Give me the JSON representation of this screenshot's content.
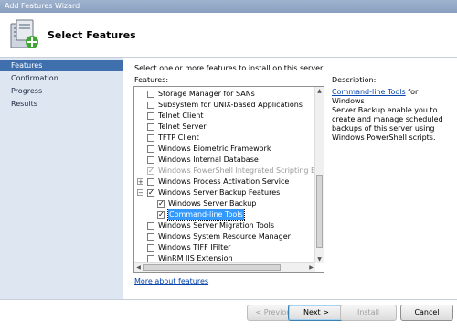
{
  "window": {
    "title": "Add Features Wizard"
  },
  "header": {
    "title": "Select Features",
    "icon": "wizard-server-icon"
  },
  "nav": {
    "items": [
      {
        "label": "Features",
        "active": true
      },
      {
        "label": "Confirmation",
        "active": false
      },
      {
        "label": "Progress",
        "active": false
      },
      {
        "label": "Results",
        "active": false
      }
    ]
  },
  "main": {
    "intro": "Select one or more features to install on this server.",
    "features_label": "Features:",
    "features": [
      {
        "label": "Storage Manager for SANs",
        "checked": false
      },
      {
        "label": "Subsystem for UNIX-based Applications",
        "checked": false
      },
      {
        "label": "Telnet Client",
        "checked": false
      },
      {
        "label": "Telnet Server",
        "checked": false
      },
      {
        "label": "TFTP Client",
        "checked": false
      },
      {
        "label": "Windows Biometric Framework",
        "checked": false
      },
      {
        "label": "Windows Internal Database",
        "checked": false
      },
      {
        "label": "Windows PowerShell Integrated Scripting Environ",
        "checked": true,
        "disabled": true
      },
      {
        "label": "Windows Process Activation Service",
        "checked": false,
        "expander": "+"
      },
      {
        "label": "Windows Server Backup Features",
        "checked": true,
        "expander": "−"
      },
      {
        "label": "Windows Server Backup",
        "checked": true,
        "indent": 1
      },
      {
        "label": "Command-line Tools",
        "checked": true,
        "indent": 1,
        "selected": true
      },
      {
        "label": "Windows Server Migration Tools",
        "checked": false
      },
      {
        "label": "Windows System Resource Manager",
        "checked": false
      },
      {
        "label": "Windows TIFF IFilter",
        "checked": false
      },
      {
        "label": "WinRM IIS Extension",
        "checked": false
      }
    ],
    "more_link": "More about features"
  },
  "description": {
    "heading": "Description:",
    "link": "Command-line Tools",
    "line1": " for Windows",
    "line2": "Server Backup enable you to",
    "line3": "create and manage scheduled",
    "line4": "backups of this server using",
    "line5": "Windows PowerShell scripts."
  },
  "buttons": {
    "previous": "< Previous",
    "next": "Next >",
    "install": "Install",
    "cancel": "Cancel"
  }
}
